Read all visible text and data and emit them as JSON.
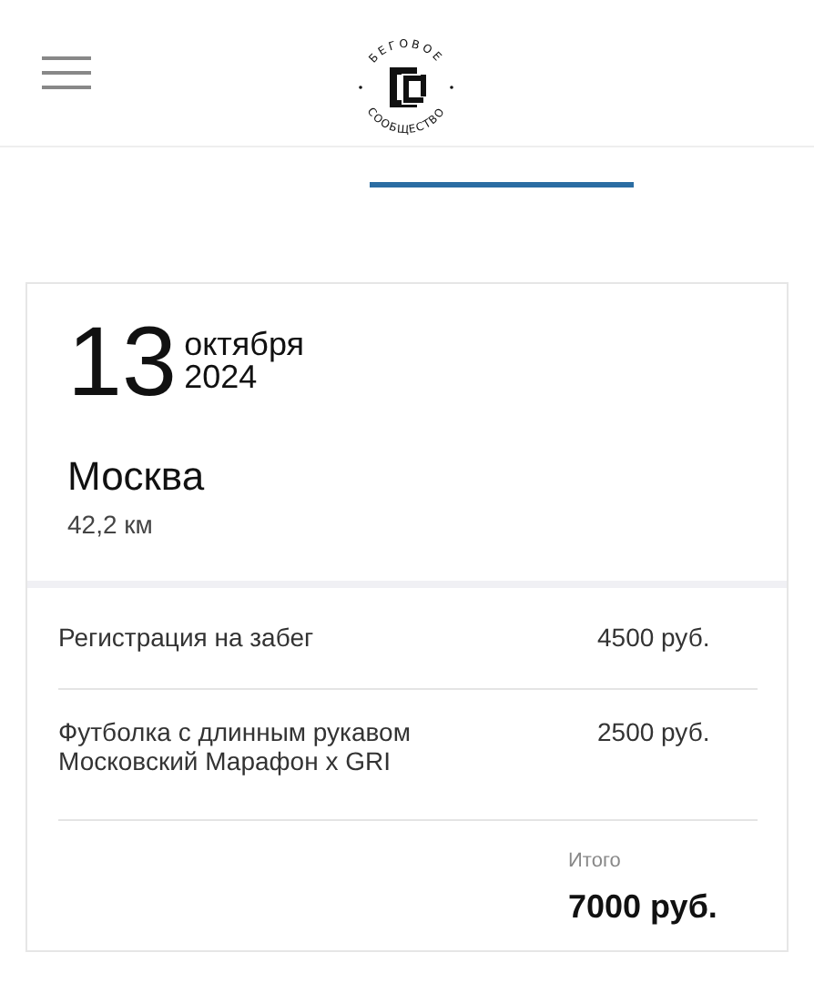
{
  "header": {
    "logo": {
      "top_text": "БЕГОВОЕ",
      "bottom_text": "СООБЩЕСТВО"
    }
  },
  "tabs": [
    {
      "selected": false
    },
    {
      "selected": true
    }
  ],
  "event": {
    "day": "13",
    "month": "октября",
    "year": "2024",
    "city": "Москва",
    "distance": "42,2 км"
  },
  "items": [
    {
      "name": "Регистрация на забег",
      "price": "4500 руб."
    },
    {
      "name": "Футболка с длинным рукавом\nМосковский Марафон x GRI",
      "price": "2500 руб."
    }
  ],
  "total": {
    "label": "Итого",
    "value": "7000 руб."
  }
}
